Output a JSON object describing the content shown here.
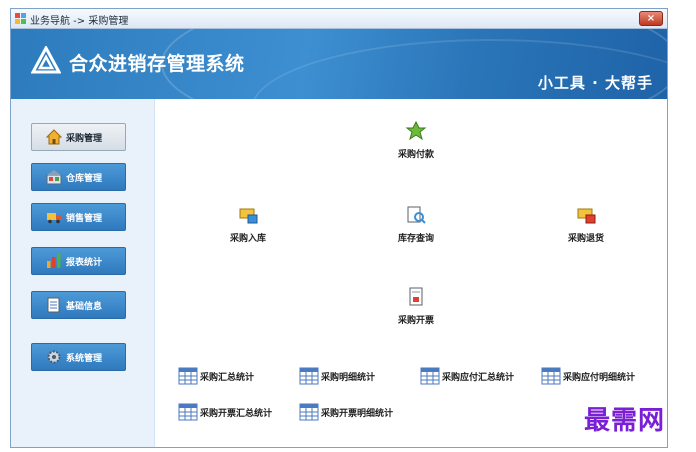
{
  "window": {
    "title": "业务导航 -> 采购管理",
    "close_label": "×"
  },
  "banner": {
    "system_title": "合众进销存管理系统",
    "tagline": "小工具 · 大帮手"
  },
  "sidebar": {
    "items": [
      {
        "label": "采购管理",
        "icon": "home-icon"
      },
      {
        "label": "仓库管理",
        "icon": "warehouse-icon"
      },
      {
        "label": "销售管理",
        "icon": "truck-icon"
      },
      {
        "label": "报表统计",
        "icon": "bar-chart-icon"
      },
      {
        "label": "基础信息",
        "icon": "document-icon"
      },
      {
        "label": "系统管理",
        "icon": "gear-icon"
      }
    ],
    "active_index": 0
  },
  "functions": {
    "payment": "采购付款",
    "stock_in": "采购入库",
    "inventory_query": "库存查询",
    "return": "采购退货",
    "invoice": "采购开票"
  },
  "reports": [
    "采购汇总统计",
    "采购明细统计",
    "采购应付汇总统计",
    "采购应付明细统计",
    "采购开票汇总统计",
    "采购开票明细统计"
  ],
  "watermark": "最需网",
  "colors": {
    "banner": "#2d7bbd",
    "nav_button": "#3a86c9",
    "sidebar_bg": "#e9f1fb",
    "watermark": "#7b1fd6"
  }
}
